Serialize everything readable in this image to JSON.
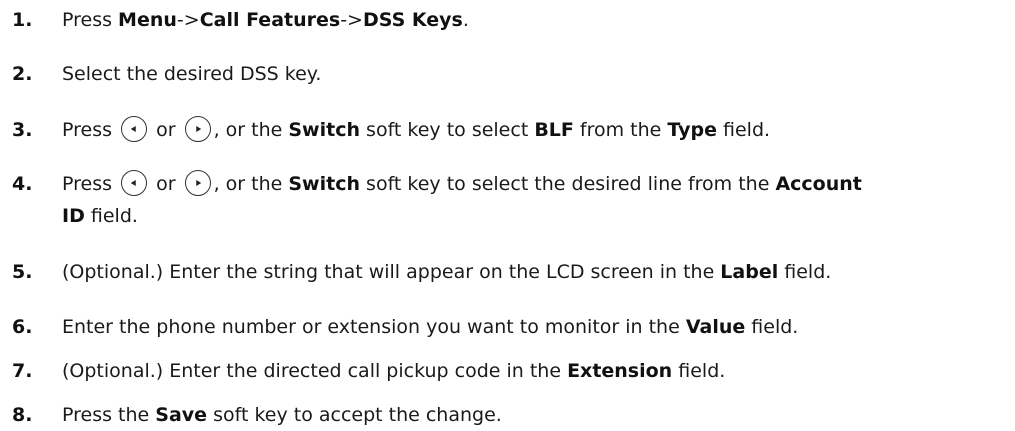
{
  "steps": [
    {
      "num": "1.",
      "parts": [
        "Press ",
        "Menu",
        "->",
        "Call Features",
        "->",
        "DSS Keys",
        "."
      ]
    },
    {
      "num": "2.",
      "text": "Select the desired DSS key."
    },
    {
      "num": "3.",
      "parts": [
        "Press",
        "or",
        ", or the ",
        "Switch",
        " soft key to select ",
        "BLF",
        " from the ",
        "Type",
        " field."
      ],
      "icons": [
        "left-arrow-key-icon",
        "right-arrow-key-icon"
      ]
    },
    {
      "num": "4.",
      "parts": [
        "Press",
        "or",
        ", or the ",
        "Switch",
        " soft key to select the desired line from the ",
        "Account",
        "ID",
        " field."
      ],
      "icons": [
        "left-arrow-key-icon",
        "right-arrow-key-icon"
      ]
    },
    {
      "num": "5.",
      "parts": [
        "(Optional.) Enter the string that will appear on the LCD screen in the ",
        "Label",
        " field."
      ]
    },
    {
      "num": "6.",
      "parts": [
        "Enter the phone number or extension you want to monitor in the ",
        "Value",
        " field."
      ]
    },
    {
      "num": "7.",
      "parts": [
        "(Optional.) Enter the directed call pickup code in the ",
        "Extension",
        " field."
      ]
    },
    {
      "num": "8.",
      "parts": [
        "Press the ",
        "Save",
        " soft key to accept the change."
      ]
    }
  ]
}
